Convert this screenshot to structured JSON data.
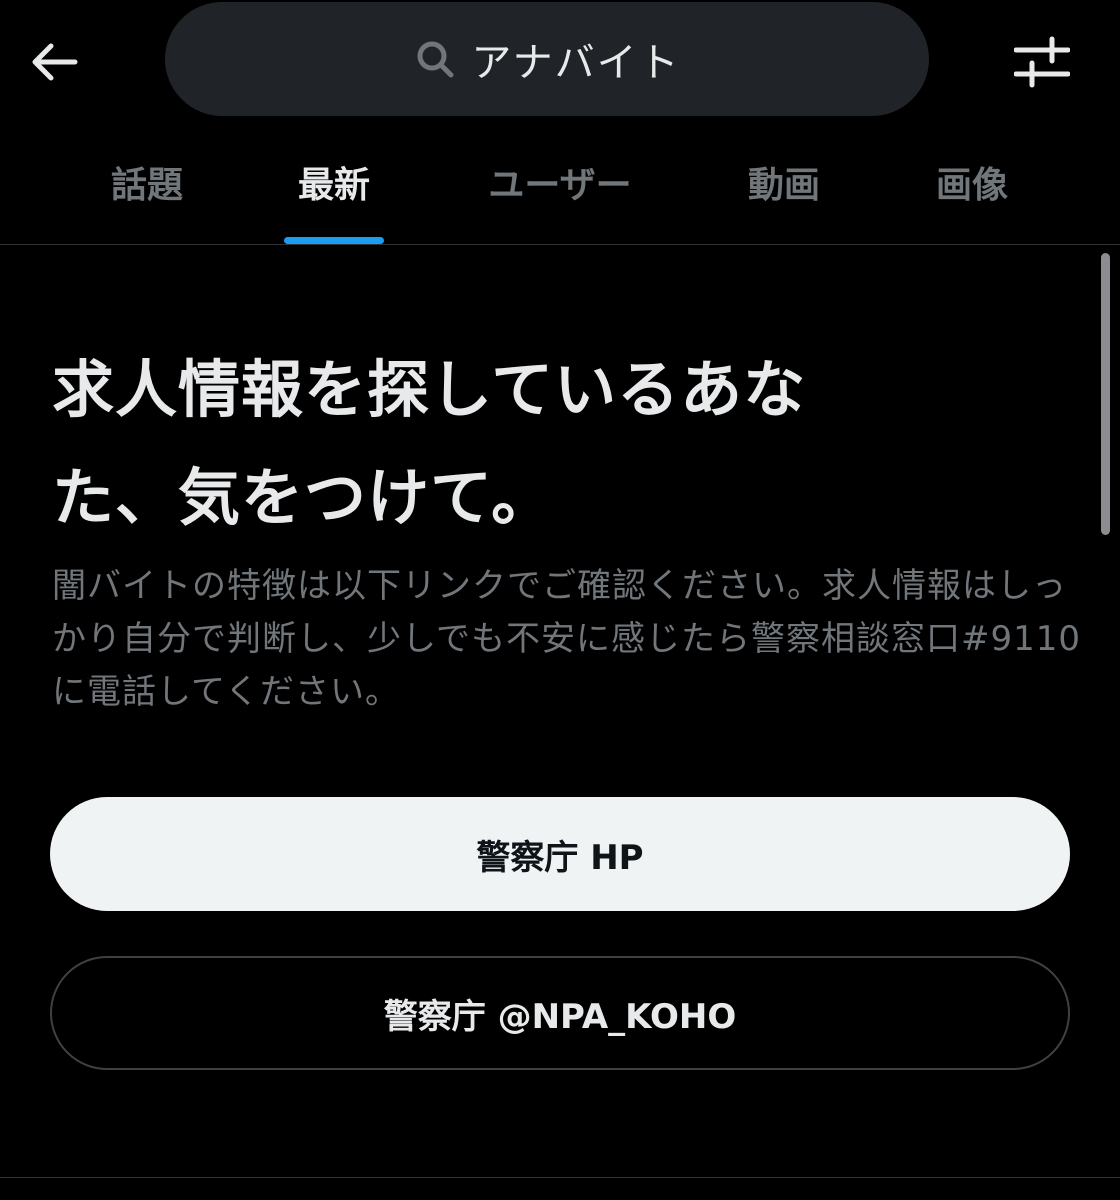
{
  "search": {
    "query": "アナバイト"
  },
  "tabs": [
    {
      "label": "話題",
      "active": false
    },
    {
      "label": "最新",
      "active": true
    },
    {
      "label": "ユーザー",
      "active": false
    },
    {
      "label": "動画",
      "active": false
    },
    {
      "label": "画像",
      "active": false
    }
  ],
  "notice": {
    "headline_line1": "求人情報を探しているあな",
    "headline_line2": "た、気をつけて。",
    "description": "闇バイトの特徴は以下リンクでご確認ください。求人情報はしっかり自分で判断し、少しでも不安に感じたら警察相談窓口#9110に電話してください。"
  },
  "buttons": {
    "primary_label": "警察庁 HP",
    "secondary_label": "警察庁 @NPA_KOHO"
  },
  "icons": {
    "back": "arrow-left-icon",
    "search": "search-icon",
    "filter": "sliders-icon"
  },
  "colors": {
    "background": "#000000",
    "search_pill": "#202327",
    "text_primary": "#e7e9ea",
    "text_secondary": "#71767b",
    "accent": "#1d9bf0",
    "button_primary_bg": "#eff3f4",
    "button_secondary_border": "#3e4144"
  }
}
